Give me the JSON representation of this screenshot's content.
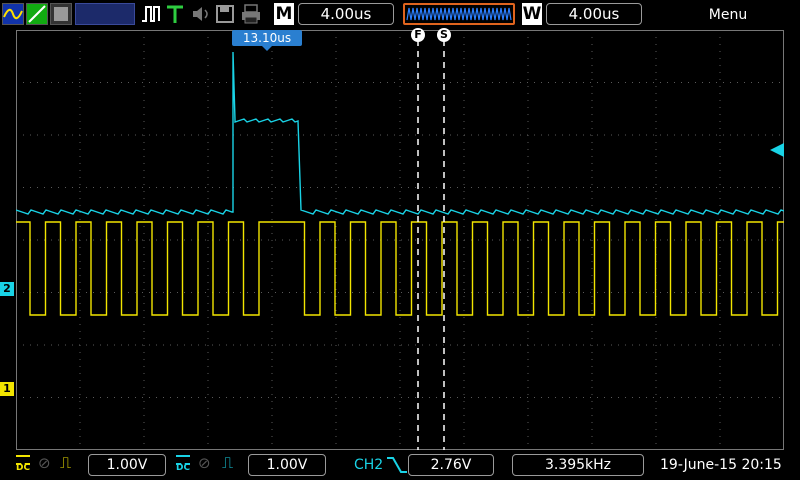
{
  "colors": {
    "ch1": "#f2e500",
    "ch2": "#19d3e6",
    "grid": "#5a5a5a",
    "accent_orange": "#e0641e",
    "wave_blue": "#2b7fff"
  },
  "icons": [
    "channel-ch1-icon",
    "ch2-icon",
    "cursor-icon",
    "pulse-icon",
    "t-trigger-icon",
    "speaker-icon",
    "save-icon",
    "print-icon"
  ],
  "top": {
    "main_label": "M",
    "main_timebase": "4.00us",
    "window_label": "W",
    "window_timebase": "4.00us",
    "menu": "Menu"
  },
  "markers": {
    "time_readout": "13.10us",
    "f_label": "F",
    "s_label": "S",
    "ch1_label": "1",
    "ch2_label": "2"
  },
  "bottom": {
    "ch1_coupling": "DC",
    "ch1_volts": "1.00V",
    "ch2_coupling": "DC",
    "ch2_volts": "1.00V",
    "trigger_source": "CH2",
    "trigger_level": "2.76V",
    "frequency": "3.395kHz",
    "datetime": "19-June-15 20:15"
  }
}
